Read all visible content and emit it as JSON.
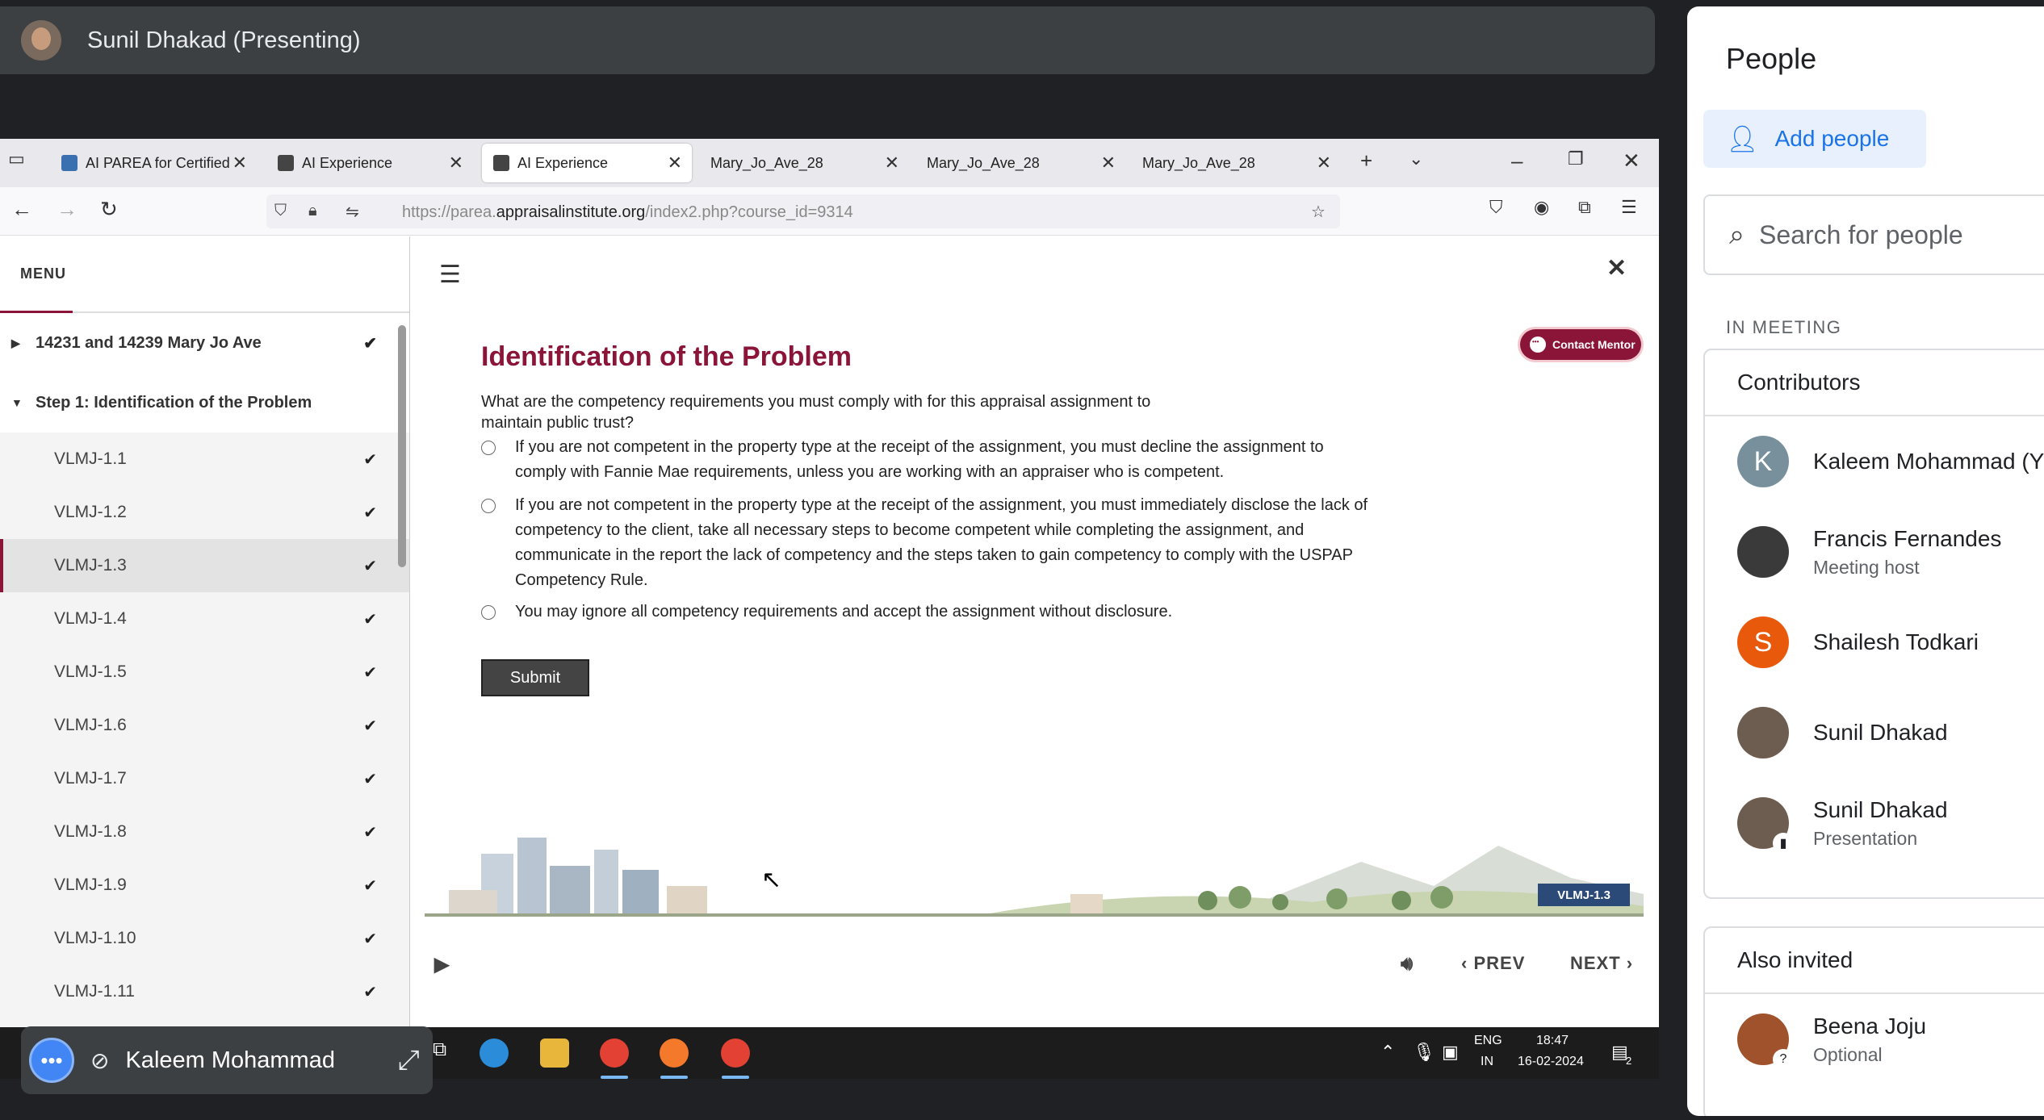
{
  "presenter": {
    "name": "Sunil Dhakad (Presenting)"
  },
  "browser": {
    "tabs": [
      {
        "label": "AI PAREA for Certified",
        "active": false
      },
      {
        "label": "AI Experience",
        "active": false
      },
      {
        "label": "AI Experience",
        "active": true
      },
      {
        "label": "Mary_Jo_Ave_28",
        "active": false
      },
      {
        "label": "Mary_Jo_Ave_28",
        "active": false
      },
      {
        "label": "Mary_Jo_Ave_28",
        "active": false
      }
    ],
    "url_prefix": "https://parea.",
    "url_domain": "appraisalinstitute.org",
    "url_path": "/index2.php?course_id=9314"
  },
  "sidebar": {
    "menu_label": "MENU",
    "section1": "14231 and 14239 Mary Jo Ave",
    "section2": "Step 1: Identification of the Problem",
    "items": [
      "VLMJ-1.1",
      "VLMJ-1.2",
      "VLMJ-1.3",
      "VLMJ-1.4",
      "VLMJ-1.5",
      "VLMJ-1.6",
      "VLMJ-1.7",
      "VLMJ-1.8",
      "VLMJ-1.9",
      "VLMJ-1.10",
      "VLMJ-1.11"
    ],
    "selected": "VLMJ-1.3"
  },
  "content": {
    "contact_mentor": "Contact Mentor",
    "title": "Identification of the Problem",
    "question": "What are the competency requirements you must comply with for this appraisal assignment to maintain public trust?",
    "options": [
      "If you are not competent in the property type at the receipt of the assignment, you must decline the assignment to comply with Fannie Mae requirements, unless you are working with an appraiser who is competent.",
      "If you are not competent in the property type at the receipt of the assignment, you must immediately disclose the lack of competency to the client, take all necessary steps to become competent while completing the assignment, and communicate in the report the lack of competency and the steps taken to gain competency to comply with the USPAP Competency Rule.",
      "You may ignore all competency requirements and accept the assignment without disclosure."
    ],
    "submit": "Submit",
    "page_badge": "VLMJ-1.3",
    "prev": "PREV",
    "next": "NEXT"
  },
  "taskbar": {
    "lang_top": "ENG",
    "lang_bottom": "IN",
    "time": "18:47",
    "date": "16-02-2024",
    "notif_count": "2"
  },
  "self_tile": {
    "name": "Kaleem Mohammad"
  },
  "people": {
    "title": "People",
    "add_people": "Add people",
    "search_placeholder": "Search for people",
    "in_meeting": "IN MEETING",
    "contributors_label": "Contributors",
    "contributors": [
      {
        "name": "Kaleem Mohammad (Y",
        "sub": "",
        "initial": "K",
        "color": "#78909c"
      },
      {
        "name": "Francis Fernandes",
        "sub": "Meeting host",
        "initial": "",
        "color": "#3a3a3a"
      },
      {
        "name": "Shailesh Todkari",
        "sub": "",
        "initial": "S",
        "color": "#e8590c"
      },
      {
        "name": "Sunil Dhakad",
        "sub": "",
        "initial": "",
        "color": "#6d5c50"
      },
      {
        "name": "Sunil Dhakad",
        "sub": "Presentation",
        "initial": "",
        "color": "#6d5c50"
      }
    ],
    "also_invited_label": "Also invited",
    "invited": [
      {
        "name": "Beena Joju",
        "sub": "Optional",
        "color": "#a0522d"
      }
    ]
  }
}
